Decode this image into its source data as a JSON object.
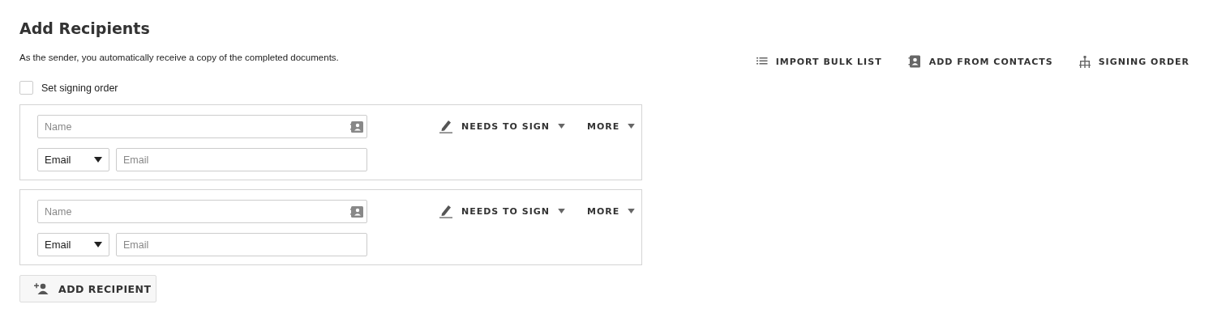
{
  "title": "Add Recipients",
  "subtitle": "As the sender, you automatically receive a copy of the completed documents.",
  "toolbar": [
    {
      "kind": "list",
      "label": "IMPORT BULK LIST"
    },
    {
      "kind": "contacts",
      "label": "ADD FROM CONTACTS"
    },
    {
      "kind": "order",
      "label": "SIGNING ORDER"
    }
  ],
  "signing_order": {
    "label": "Set signing order",
    "checked": false
  },
  "recipients": [
    {
      "name_placeholder": "Name",
      "delivery": "Email",
      "email_placeholder": "Email",
      "action": "NEEDS TO SIGN",
      "more": "MORE"
    },
    {
      "name_placeholder": "Name",
      "delivery": "Email",
      "email_placeholder": "Email",
      "action": "NEEDS TO SIGN",
      "more": "MORE"
    }
  ],
  "add_button": "ADD RECIPIENT"
}
